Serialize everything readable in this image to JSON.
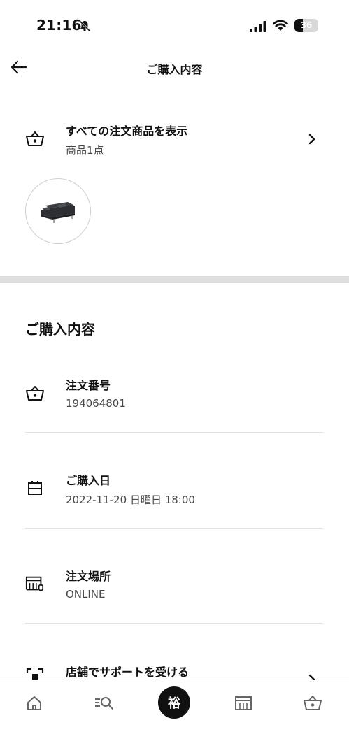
{
  "status_bar": {
    "time": "21:16",
    "battery_text": "36",
    "battery_level": 0.36
  },
  "header": {
    "title": "ご購入内容"
  },
  "all_items": {
    "title": "すべての注文商品を表示",
    "subtitle": "商品1点"
  },
  "details": {
    "heading": "ご購入内容",
    "order_number": {
      "label": "注文番号",
      "value": "194064801"
    },
    "purchase_date": {
      "label": "ご購入日",
      "value": "2022-11-20 日曜日 18:00"
    },
    "order_location": {
      "label": "注文場所",
      "value": "ONLINE"
    },
    "store_support": {
      "label": "店舗でサポートを受ける"
    }
  },
  "bottom_nav": {
    "avatar_text": "裕",
    "items": [
      "home-icon",
      "search-icon",
      "profile-avatar",
      "store-icon",
      "basket-icon"
    ]
  },
  "colors": {
    "text": "#111111",
    "secondary_text": "#484848",
    "divider": "#dfdfdf",
    "avatar_bg": "#111111"
  }
}
